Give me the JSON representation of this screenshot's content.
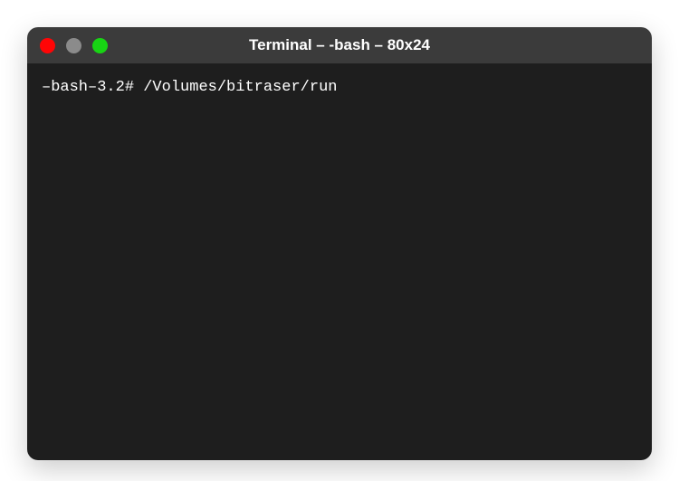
{
  "window": {
    "title": "Terminal – -bash – 80x24"
  },
  "terminal": {
    "prompt": "–bash–3.2#",
    "command": "/Volumes/bitraser/run"
  }
}
